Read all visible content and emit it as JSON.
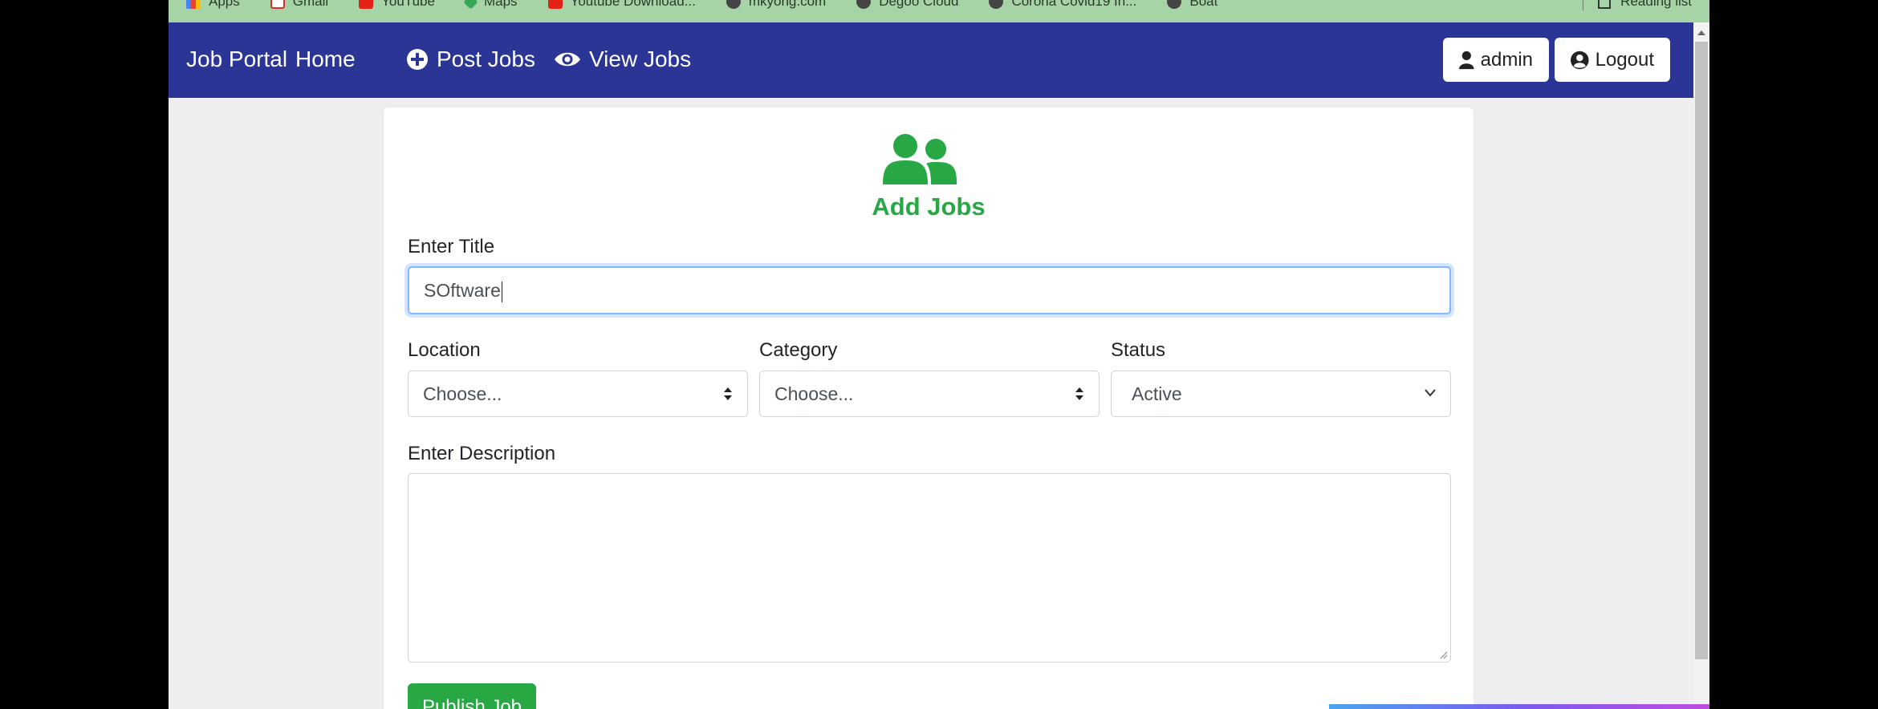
{
  "bookmarks": {
    "items": [
      "Apps",
      "Gmail",
      "YouTube",
      "Maps",
      "Youtube Download...",
      "mkyong.com",
      "Degoo Cloud",
      "Corona Covid19 In...",
      "Boat"
    ],
    "reading_list": "Reading list"
  },
  "navbar": {
    "brand": "Job Portal",
    "home": "Home",
    "post_jobs": "Post Jobs",
    "view_jobs": "View Jobs",
    "user": "admin",
    "logout": "Logout",
    "color": "#2b3595"
  },
  "form": {
    "heading": "Add Jobs",
    "title_label": "Enter Title",
    "title_value": "SOftware",
    "location_label": "Location",
    "location_value": "Choose...",
    "category_label": "Category",
    "category_value": "Choose...",
    "status_label": "Status",
    "status_value": "Active",
    "description_label": "Enter Description",
    "description_value": "",
    "publish_button": "Publish Job",
    "accent": "#28a745"
  }
}
